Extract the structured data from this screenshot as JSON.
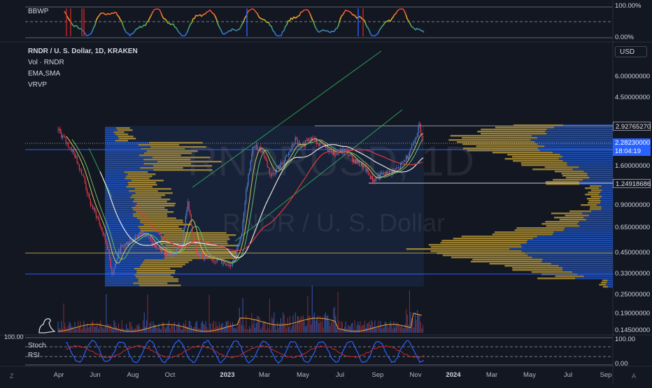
{
  "legend": {
    "title": "RNDR / U. S. Dollar, 1D, KRAKEN",
    "vol": "Vol · RNDR",
    "ema_sma": "EMA,SMA",
    "vrvp": "VRVP"
  },
  "watermark": {
    "symbol": "RNDRUSD, 1D",
    "name": "RNDR / U. S. Dollar"
  },
  "bbwp_pane": {
    "label": "BBWP",
    "top_scale": "100.00%",
    "bottom_scale": "0.00%"
  },
  "osc_pane": {
    "label1": "Stoch",
    "label2": "RSI",
    "left_scale": "100.00",
    "top_scale": "100.00",
    "bottom_scale": "0.00"
  },
  "currency": "USD",
  "price_axis": [
    "6.00000000",
    "4.50000000",
    "1.60000000",
    "0.90000000",
    "0.65000000",
    "0.45000000",
    "0.33000000",
    "0.25000000",
    "0.19000000",
    "0.14500000"
  ],
  "price_tags": {
    "high": "2.92765270",
    "last": "2.28230000",
    "countdown": "18:04:19",
    "support": "1.24918686"
  },
  "time_axis": [
    "Apr",
    "Jun",
    "Aug",
    "Oct",
    "2023",
    "Mar",
    "May",
    "Jul",
    "Sep",
    "Nov",
    "2024",
    "Mar",
    "May",
    "Jul",
    "Sep"
  ],
  "corner": {
    "left": "Z",
    "right": "A"
  },
  "colors": {
    "background": "#131722",
    "up": "#4a7fdb",
    "down": "#f23645",
    "vp_up": "#1f4fb3",
    "vp_down": "#a68a34",
    "ema_red": "#e53935",
    "sma_white": "#e6e6e6",
    "ema_green": "#66bb6a",
    "ema_yellow": "#d6c75a",
    "trend_green": "#2e9e5a",
    "hline_gold": "#b89a3c",
    "hline_blue": "#2962ff"
  },
  "chart_data": {
    "type": "line",
    "title": "RNDR / U. S. Dollar, 1D, KRAKEN",
    "xlabel": "",
    "ylabel": "",
    "y_scale": "log",
    "ylim": [
      0.14,
      8.0
    ],
    "x": [
      "2022-03-20",
      "2022-04-01",
      "2022-04-15",
      "2022-05-01",
      "2022-05-12",
      "2022-05-25",
      "2022-06-10",
      "2022-06-18",
      "2022-07-01",
      "2022-07-20",
      "2022-08-10",
      "2022-08-25",
      "2022-09-10",
      "2022-09-25",
      "2022-10-10",
      "2022-10-20",
      "2022-10-28",
      "2022-11-05",
      "2022-11-20",
      "2022-12-05",
      "2022-12-20",
      "2022-12-30",
      "2023-01-15",
      "2023-01-25",
      "2023-02-05",
      "2023-02-20",
      "2023-03-05",
      "2023-03-20",
      "2023-04-01",
      "2023-04-15",
      "2023-04-25",
      "2023-05-05",
      "2023-05-20",
      "2023-06-05",
      "2023-06-20",
      "2023-07-05",
      "2023-07-20",
      "2023-08-05",
      "2023-08-20",
      "2023-09-01",
      "2023-09-15",
      "2023-10-01",
      "2023-10-15",
      "2023-10-25",
      "2023-11-05",
      "2023-11-12"
    ],
    "series": [
      {
        "name": "RNDR",
        "values": [
          2.8,
          2.4,
          2.0,
          1.4,
          0.95,
          0.75,
          0.5,
          0.33,
          0.48,
          0.55,
          0.62,
          0.5,
          0.46,
          0.44,
          0.5,
          0.95,
          0.6,
          0.45,
          0.42,
          0.41,
          0.39,
          0.38,
          0.55,
          1.2,
          2.2,
          2.05,
          1.4,
          1.6,
          1.85,
          2.4,
          2.1,
          2.5,
          2.35,
          2.1,
          1.95,
          2.05,
          1.75,
          1.6,
          1.3,
          1.4,
          1.45,
          1.55,
          1.85,
          2.3,
          2.95,
          2.28
        ]
      }
    ],
    "horizontal_levels": [
      2.9276527,
      1.24918686,
      0.45,
      0.33
    ],
    "last_price": 2.2823,
    "panes": [
      {
        "name": "BBWP",
        "ylim": [
          0,
          100
        ]
      },
      {
        "name": "Stoch",
        "ylim": [
          0,
          100
        ]
      },
      {
        "name": "RSI",
        "ylim": [
          0,
          100
        ]
      }
    ]
  }
}
